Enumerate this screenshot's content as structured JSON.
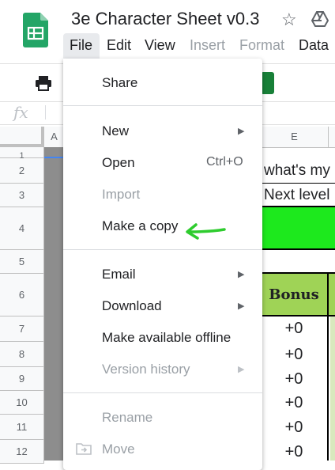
{
  "header": {
    "title": "3e Character Sheet v0.3",
    "menus": [
      {
        "label": "File",
        "disabled": false
      },
      {
        "label": "Edit",
        "disabled": false
      },
      {
        "label": "View",
        "disabled": false
      },
      {
        "label": "Insert",
        "disabled": true
      },
      {
        "label": "Format",
        "disabled": true
      },
      {
        "label": "Data",
        "disabled": false
      }
    ]
  },
  "formula_bar": {
    "fx": "fx"
  },
  "grid": {
    "col_headers": [
      "A",
      "E"
    ],
    "row_headers": [
      "1",
      "2",
      "3",
      "4",
      "5",
      "6",
      "7",
      "8",
      "9",
      "10",
      "11",
      "12"
    ],
    "cells": {
      "e2": "what's my",
      "e3": "Next level",
      "bonus_header": "Bonus",
      "bonus_values": [
        "+0",
        "+0",
        "+0",
        "+0",
        "+0",
        "+0"
      ]
    },
    "colors": {
      "green_bar": "#1de91d",
      "bonus_header_bg": "#9fd356",
      "bonus_col_bg": "#d8e9bd"
    }
  },
  "file_menu": {
    "items": [
      {
        "label": "Share"
      },
      {
        "label": "New",
        "submenu": true
      },
      {
        "label": "Open",
        "shortcut": "Ctrl+O"
      },
      {
        "label": "Import",
        "disabled": true
      },
      {
        "label": "Make a copy"
      },
      {
        "label": "Email",
        "submenu": true
      },
      {
        "label": "Download",
        "submenu": true
      },
      {
        "label": "Make available offline"
      },
      {
        "label": "Version history",
        "disabled": true,
        "submenu": true
      },
      {
        "label": "Rename",
        "disabled": true
      },
      {
        "label": "Move",
        "disabled": true
      }
    ]
  },
  "annotation": {
    "color": "#2ecc2e",
    "icon": "green-arrow-icon"
  }
}
